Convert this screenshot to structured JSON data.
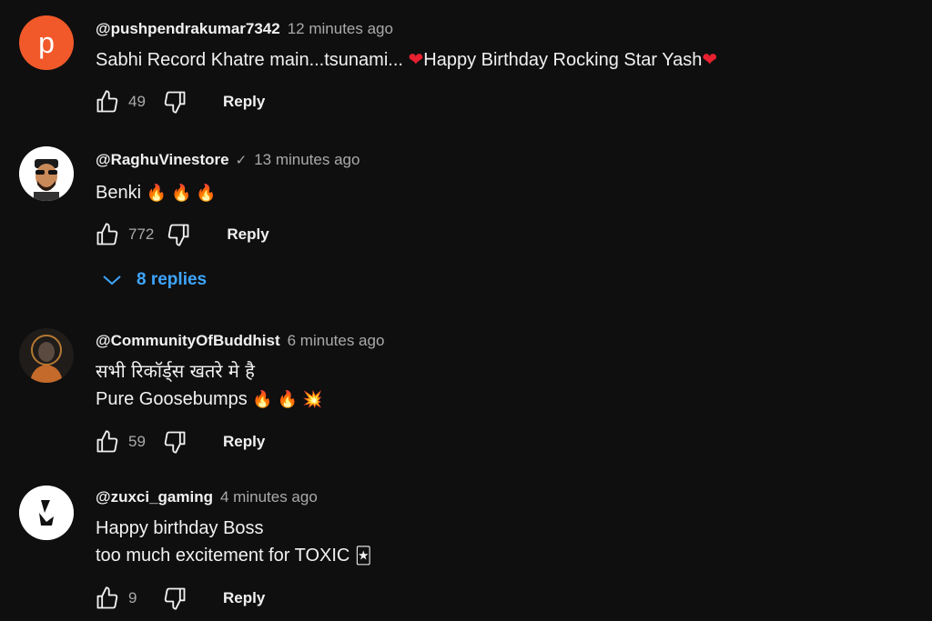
{
  "comments": [
    {
      "author": "@pushpendrakumar7342",
      "avatar_letter": "p",
      "time": "12 minutes ago",
      "lines": [
        "Sabhi Record Khatre main...tsunami... ",
        "Happy Birthday Rocking Star Yash"
      ],
      "likes": "49",
      "reply_label": "Reply"
    },
    {
      "author": "@RaghuVinestore",
      "verified_mark": "✓",
      "time": "13 minutes ago",
      "lines": [
        "Benki",
        "🔥 🔥 🔥"
      ],
      "likes": "772",
      "reply_label": "Reply",
      "replies_label": "8 replies"
    },
    {
      "author": "@CommunityOfBuddhist",
      "time": "6 minutes ago",
      "lines": [
        "सभी रिकॉर्ड्स खतरे मे है",
        " Pure Goosebumps",
        "🔥 🔥 💥"
      ],
      "likes": "59",
      "reply_label": "Reply"
    },
    {
      "author": "@zuxci_gaming",
      "time": "4 minutes ago",
      "lines": [
        "Happy birthday Boss",
        "too much excitement for TOXIC",
        "🃏"
      ],
      "likes": "9",
      "reply_label": "Reply"
    }
  ],
  "icons": {
    "heart": "❤",
    "like": "thumbs-up-icon",
    "dislike": "thumbs-down-icon",
    "chevron": "chevron-down-icon"
  },
  "colors": {
    "background": "#0f0f0f",
    "text": "#f1f1f1",
    "secondary": "#aaaaaa",
    "link": "#3ea6ff",
    "heart": "#e8202f",
    "avatar_orange": "#f1592a"
  }
}
